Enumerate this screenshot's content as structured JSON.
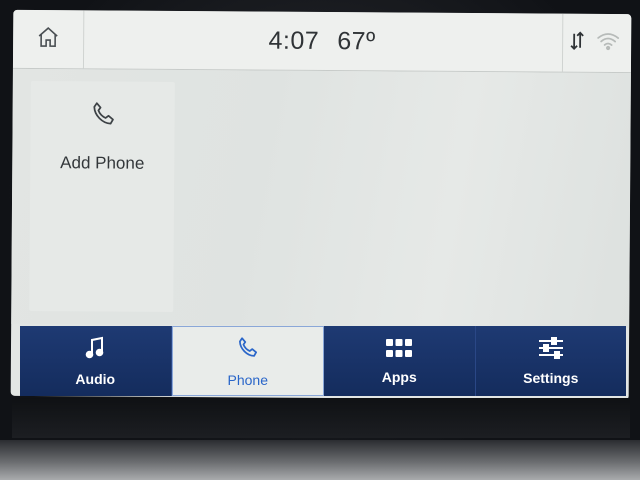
{
  "status_bar": {
    "time": "4:07",
    "temperature": "67º",
    "icons": [
      "home-icon",
      "data-transfer-icon",
      "wifi-icon"
    ]
  },
  "content": {
    "add_phone_label": "Add Phone",
    "add_phone_icon": "phone-icon"
  },
  "nav": {
    "items": [
      {
        "label": "Audio",
        "icon": "music-note-icon",
        "active": false
      },
      {
        "label": "Phone",
        "icon": "phone-icon",
        "active": true
      },
      {
        "label": "Apps",
        "icon": "apps-grid-icon",
        "active": false
      },
      {
        "label": "Settings",
        "icon": "sliders-icon",
        "active": false
      }
    ]
  },
  "colors": {
    "nav_background": "#1a3468",
    "active_tab_background": "#e9ecea",
    "active_tab_text": "#2a66c9",
    "screen_background": "#e3e6e4"
  }
}
